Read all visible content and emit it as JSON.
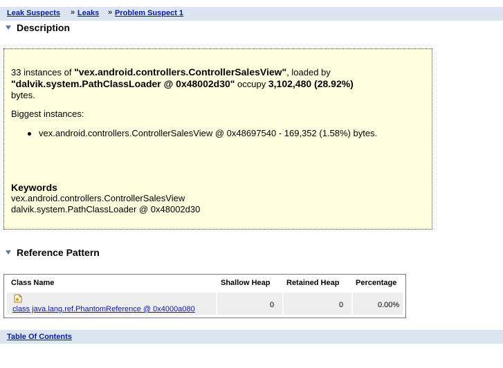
{
  "breadcrumb": {
    "items": [
      "Leak Suspects",
      "Leaks",
      "Problem Suspect 1"
    ],
    "separator": "»"
  },
  "description": {
    "heading": "Description",
    "count_prefix": "33 instances of ",
    "class_name": "\"vex.android.controllers.ControllerSalesView\"",
    "loaded_by_text": ", loaded by",
    "loader": "\"dalvik.system.PathClassLoader @ 0x48002d30\"",
    "occupy_text": " occupy ",
    "size": "3,102,480 (28.92%)",
    "bytes_text": "bytes.",
    "biggest_label": "Biggest instances:",
    "biggest_item": "vex.android.controllers.ControllerSalesView @ 0x48697540 - 169,352 (1.58%) bytes.",
    "keywords_title": "Keywords",
    "keywords": [
      "vex.android.controllers.ControllerSalesView",
      "dalvik.system.PathClassLoader @ 0x48002d30"
    ]
  },
  "reference_pattern": {
    "heading": "Reference Pattern",
    "columns": [
      "Class Name",
      "Shallow Heap",
      "Retained Heap",
      "Percentage"
    ],
    "rows": [
      {
        "icon": "class-file-icon",
        "class_name": "class java.lang.ref.PhantomReference @ 0x4000a080",
        "shallow_heap": "0",
        "retained_heap": "0",
        "percentage": "0.00%"
      }
    ]
  },
  "footer": {
    "toc_label": "Table Of Contents"
  },
  "colors": {
    "bar_background": "#dbe5ef",
    "description_background": "#ffffe0",
    "link": "#0b1a9c",
    "row_background": "#eeeeee"
  }
}
